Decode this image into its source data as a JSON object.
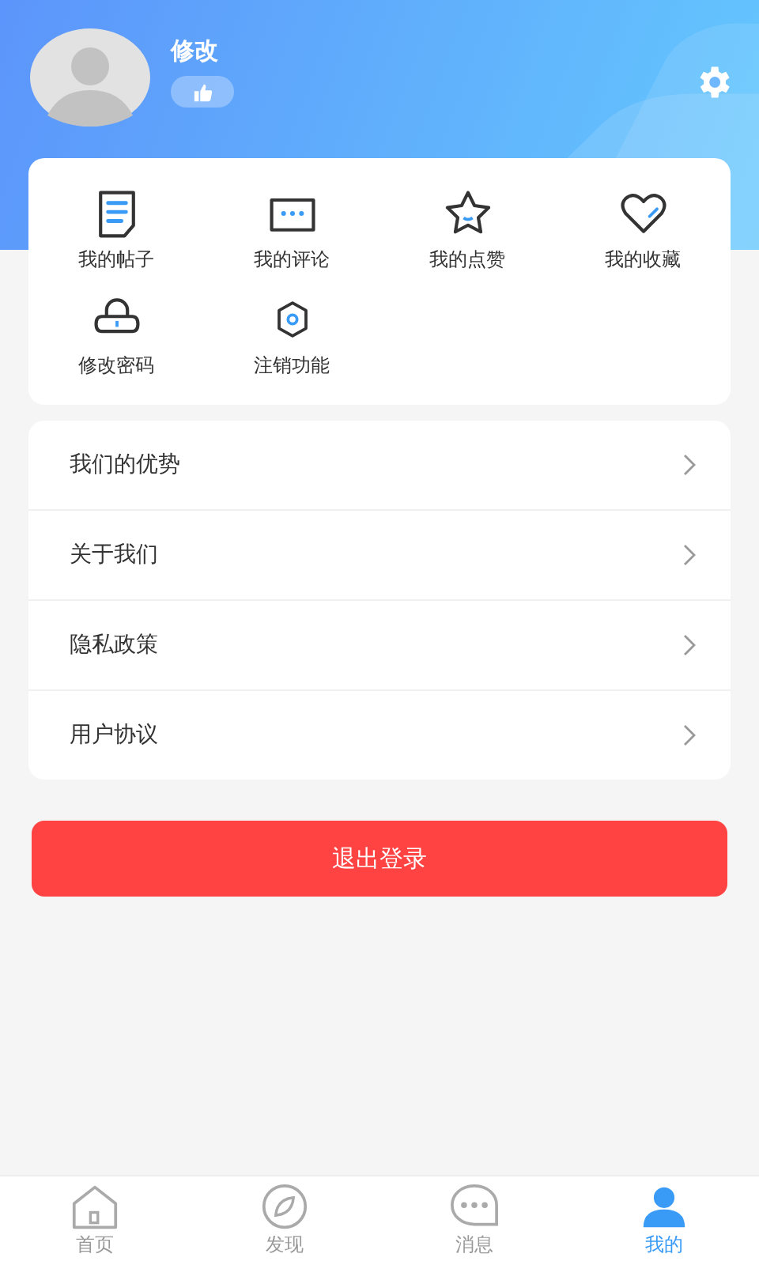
{
  "profile": {
    "name": "修改"
  },
  "shortcuts": [
    {
      "label": "我的帖子"
    },
    {
      "label": "我的评论"
    },
    {
      "label": "我的点赞"
    },
    {
      "label": "我的收藏"
    },
    {
      "label": "修改密码"
    },
    {
      "label": "注销功能"
    }
  ],
  "menu": [
    {
      "label": "我们的优势"
    },
    {
      "label": "关于我们"
    },
    {
      "label": "隐私政策"
    },
    {
      "label": "用户协议"
    }
  ],
  "logout_button": "退出登录",
  "tabs": [
    {
      "label": "首页",
      "selected": false
    },
    {
      "label": "发现",
      "selected": false
    },
    {
      "label": "消息",
      "selected": false
    },
    {
      "label": "我的",
      "selected": true
    }
  ]
}
